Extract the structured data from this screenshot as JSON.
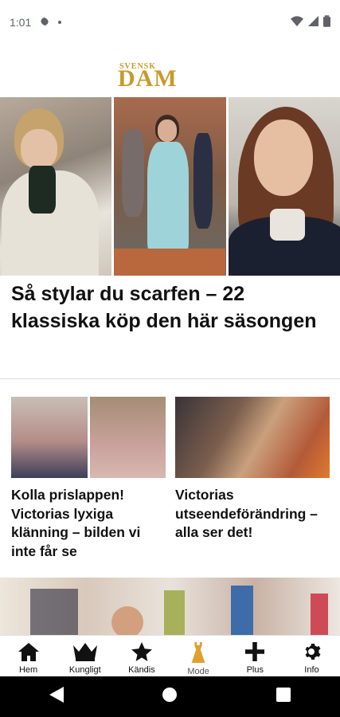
{
  "status": {
    "time": "1:01"
  },
  "logo": {
    "line1": "SVENSK",
    "line2": "DAM"
  },
  "hero": {
    "title": "Så stylar du scarfen – 22 klassiska köp den här säsongen"
  },
  "cards": [
    {
      "title": "Kolla prislappen! Victorias lyxiga klänning – bilden vi inte får se"
    },
    {
      "title": "Victorias utseendeförändring – alla ser det!"
    }
  ],
  "nav": {
    "items": [
      {
        "label": "Hem",
        "icon": "home-icon"
      },
      {
        "label": "Kungligt",
        "icon": "crown-icon"
      },
      {
        "label": "Kändis",
        "icon": "star-icon"
      },
      {
        "label": "Mode",
        "icon": "dress-icon"
      },
      {
        "label": "Plus",
        "icon": "plus-icon"
      },
      {
        "label": "Info",
        "icon": "gear-icon"
      }
    ],
    "active": "Mode"
  },
  "colors": {
    "brand_gold": "#c79a2b",
    "active_nav": "#e0a030"
  }
}
